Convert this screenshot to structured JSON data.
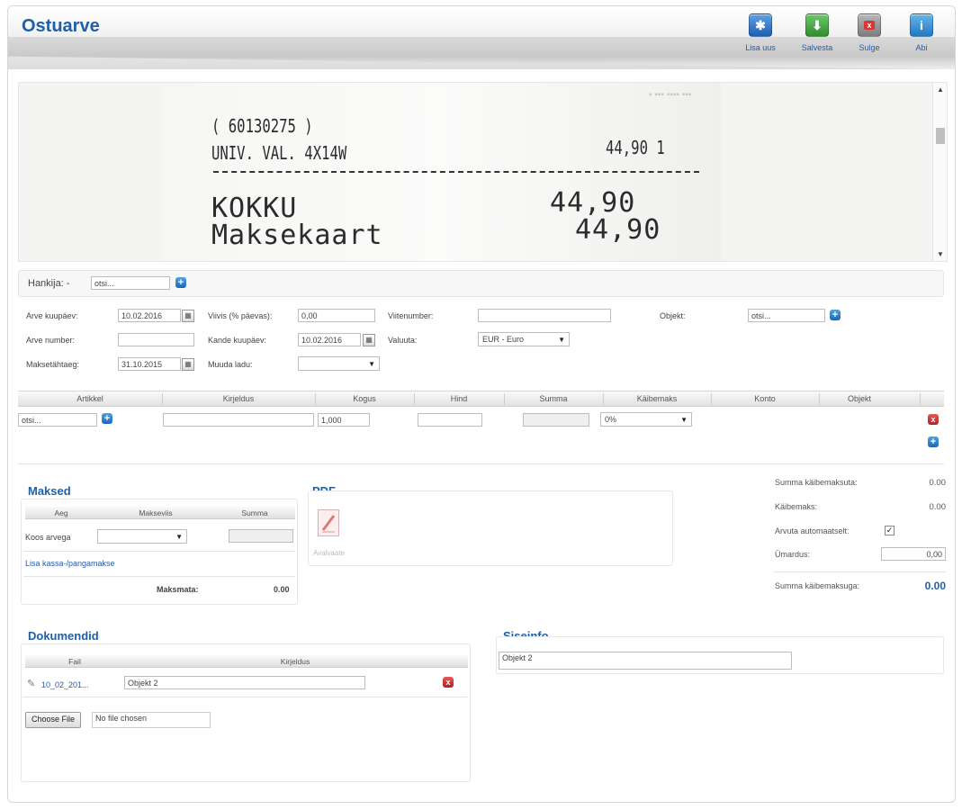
{
  "header": {
    "title": "Ostuarve"
  },
  "toolbar": {
    "new_label": "Lisa uus",
    "save_label": "Salvesta",
    "close_label": "Sulge",
    "help_label": "Abi"
  },
  "receipt": {
    "code": "( 60130275 )",
    "item": "UNIV. VAL. 4X14W",
    "item_amount": "44,90 1",
    "total_label": "KOKKU",
    "total_value": "44,90",
    "payment_label": "Maksekaart",
    "payment_value": "44,90"
  },
  "supplier": {
    "label": "Hankija: -",
    "value": "otsi..."
  },
  "form": {
    "invoice_date_label": "Arve kuupäev:",
    "invoice_date": "10.02.2016",
    "invoice_number_label": "Arve number:",
    "invoice_number": "",
    "due_date_label": "Maksetähtaeg:",
    "due_date": "31.10.2015",
    "penalty_label": "Viivis (% päevas):",
    "penalty": "0,00",
    "entry_date_label": "Kande kuupäev:",
    "entry_date": "10.02.2016",
    "warehouse_label": "Muuda ladu:",
    "warehouse": "",
    "reference_label": "Viitenumber:",
    "reference": "",
    "currency_label": "Valuuta:",
    "currency": "EUR - Euro",
    "object_label": "Objekt:",
    "object_value": "otsi..."
  },
  "grid": {
    "columns": [
      "Artikkel",
      "Kirjeldus",
      "Kogus",
      "Hind",
      "Summa",
      "Käibemaks",
      "Konto",
      "Objekt"
    ],
    "row": {
      "article": "otsi...",
      "description": "",
      "quantity": "1,000",
      "price": "",
      "sum": "",
      "vat": "0%"
    }
  },
  "payments": {
    "title": "Maksed",
    "columns": [
      "Aeg",
      "Makseviis",
      "Summa"
    ],
    "row_time": "Koos arvega",
    "row_method": "",
    "add_link": "Lisa kassa-/pangamakse",
    "unpaid_label": "Maksmata:",
    "unpaid_value": "0.00"
  },
  "pdf": {
    "title": "PDF",
    "caption": "Avalvaate"
  },
  "totals": {
    "net_label": "Summa käibemaksuta:",
    "net_value": "0.00",
    "vat_label": "Käibemaks:",
    "vat_value": "0.00",
    "auto_label": "Arvuta automaatselt:",
    "rounding_label": "Ümardus:",
    "rounding_value": "0,00",
    "gross_label": "Summa käibemaksuga:",
    "gross_value": "0.00"
  },
  "documents": {
    "title": "Dokumendid",
    "columns": [
      "Fail",
      "Kirjeldus"
    ],
    "file_name": "10_02_201...",
    "file_description": "Objekt 2",
    "choose_file_label": "Choose File",
    "no_file_label": "No file chosen"
  },
  "siseinfo": {
    "title": "Siseinfo",
    "value": "Objekt 2"
  }
}
